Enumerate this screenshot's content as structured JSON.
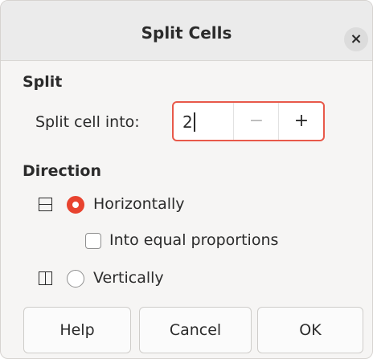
{
  "dialog": {
    "title": "Split Cells",
    "close_glyph": "×"
  },
  "split": {
    "heading": "Split",
    "label": "Split cell into:",
    "value": "2",
    "minus_glyph": "−",
    "plus_glyph": "+"
  },
  "direction": {
    "heading": "Direction",
    "horizontally": {
      "label": "Horizontally",
      "selected": true
    },
    "equal_proportions": {
      "label": "Into equal proportions",
      "checked": false
    },
    "vertically": {
      "label": "Vertically",
      "selected": false
    }
  },
  "buttons": {
    "help": "Help",
    "cancel": "Cancel",
    "ok": "OK"
  },
  "colors": {
    "accent": "#e8432f",
    "focus_border": "#e8594a"
  }
}
